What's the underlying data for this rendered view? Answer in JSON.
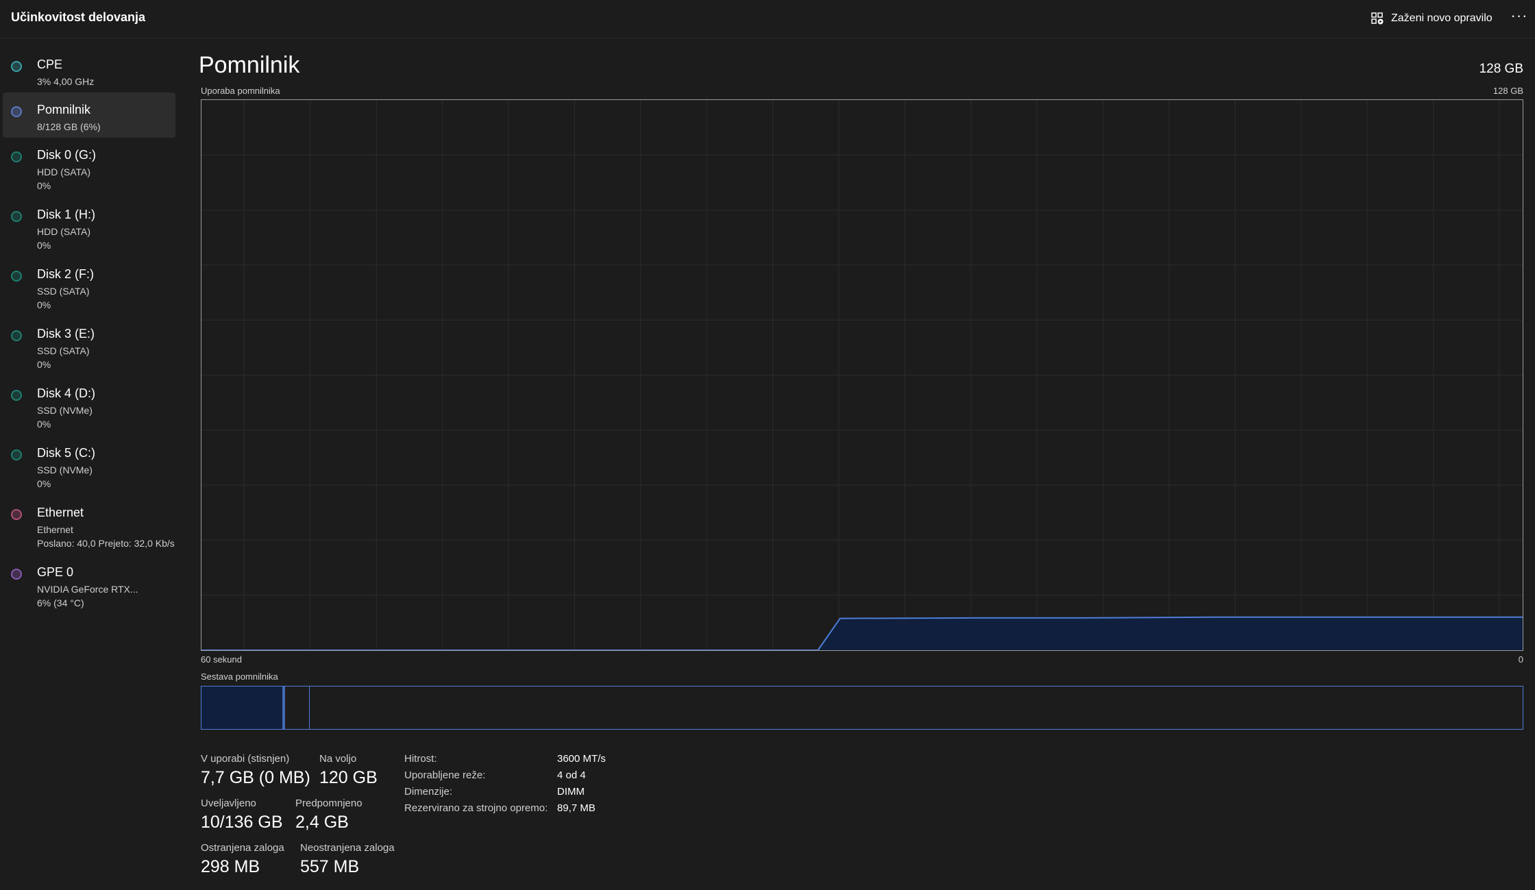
{
  "window": {
    "title": "Učinkovitost delovanja",
    "run_task_label": "Zaženi novo opravilo",
    "more_label": "···"
  },
  "sidebar": {
    "items": [
      {
        "name": "CPE",
        "sub1": "3% 4,00 GHz",
        "sub2": "",
        "color": "#3aa0a8",
        "selected": false
      },
      {
        "name": "Pomnilnik",
        "sub1": "8/128 GB (6%)",
        "sub2": "",
        "color": "#5a78c8",
        "selected": true
      },
      {
        "name": "Disk 0 (G:)",
        "sub1": "HDD (SATA)",
        "sub2": "0%",
        "color": "#1f7f70",
        "selected": false
      },
      {
        "name": "Disk 1 (H:)",
        "sub1": "HDD (SATA)",
        "sub2": "0%",
        "color": "#1f7f70",
        "selected": false
      },
      {
        "name": "Disk 2 (F:)",
        "sub1": "SSD (SATA)",
        "sub2": "0%",
        "color": "#1f7f70",
        "selected": false
      },
      {
        "name": "Disk 3 (E:)",
        "sub1": "SSD (SATA)",
        "sub2": "0%",
        "color": "#1f7f70",
        "selected": false
      },
      {
        "name": "Disk 4 (D:)",
        "sub1": "SSD (NVMe)",
        "sub2": "0%",
        "color": "#1f7f70",
        "selected": false
      },
      {
        "name": "Disk 5 (C:)",
        "sub1": "SSD (NVMe)",
        "sub2": "0%",
        "color": "#1f7f70",
        "selected": false
      },
      {
        "name": "Ethernet",
        "sub1": "Ethernet",
        "sub2": "Poslano: 40,0 Prejeto: 32,0 Kb/s",
        "color": "#b0507a",
        "selected": false
      },
      {
        "name": "GPE 0",
        "sub1": "NVIDIA GeForce RTX...",
        "sub2": "6% (34 °C)",
        "color": "#8a5ab0",
        "selected": false
      }
    ]
  },
  "main": {
    "title": "Pomnilnik",
    "total": "128 GB",
    "usage_label": "Uporaba pomnilnika",
    "usage_max": "128 GB",
    "time_label_left": "60 sekund",
    "time_label_right": "0",
    "composition_label": "Sestava pomnilnika"
  },
  "chart_data": {
    "type": "area",
    "title": "Uporaba pomnilnika",
    "xlabel": "",
    "ylabel": "",
    "x_range_seconds": [
      60,
      0
    ],
    "ylim_gb": [
      0,
      128
    ],
    "grid": true,
    "color": "#4f7ed8",
    "fill": "#0f1f3d",
    "points_seconds_ago": [
      60,
      50,
      40,
      32,
      31,
      25,
      20,
      14,
      10,
      5,
      0
    ],
    "values_gb": [
      0,
      0,
      0,
      0,
      7.4,
      7.5,
      7.5,
      7.7,
      7.7,
      7.7,
      7.7
    ]
  },
  "composition": {
    "in_use_fraction": 0.061,
    "modified_fraction": 0.002,
    "standby_fraction": 0.019,
    "fill_color": "#0f1f3d",
    "border_color": "#4f7ed8"
  },
  "stats": {
    "in_use_label": "V uporabi (stisnjen)",
    "in_use_value": "7,7 GB (0 MB)",
    "available_label": "Na voljo",
    "available_value": "120 GB",
    "committed_label": "Uveljavljeno",
    "committed_value": "10/136 GB",
    "cached_label": "Predpomnjeno",
    "cached_value": "2,4 GB",
    "paged_label": "Ostranjena zaloga",
    "paged_value": "298 MB",
    "nonpaged_label": "Neostranjena zaloga",
    "nonpaged_value": "557 MB"
  },
  "properties": [
    {
      "label": "Hitrost:",
      "value": "3600 MT/s"
    },
    {
      "label": "Uporabljene reže:",
      "value": "4 od 4"
    },
    {
      "label": "Dimenzije:",
      "value": "DIMM"
    },
    {
      "label": "Rezervirano za strojno opremo:",
      "value": "89,7 MB"
    }
  ]
}
